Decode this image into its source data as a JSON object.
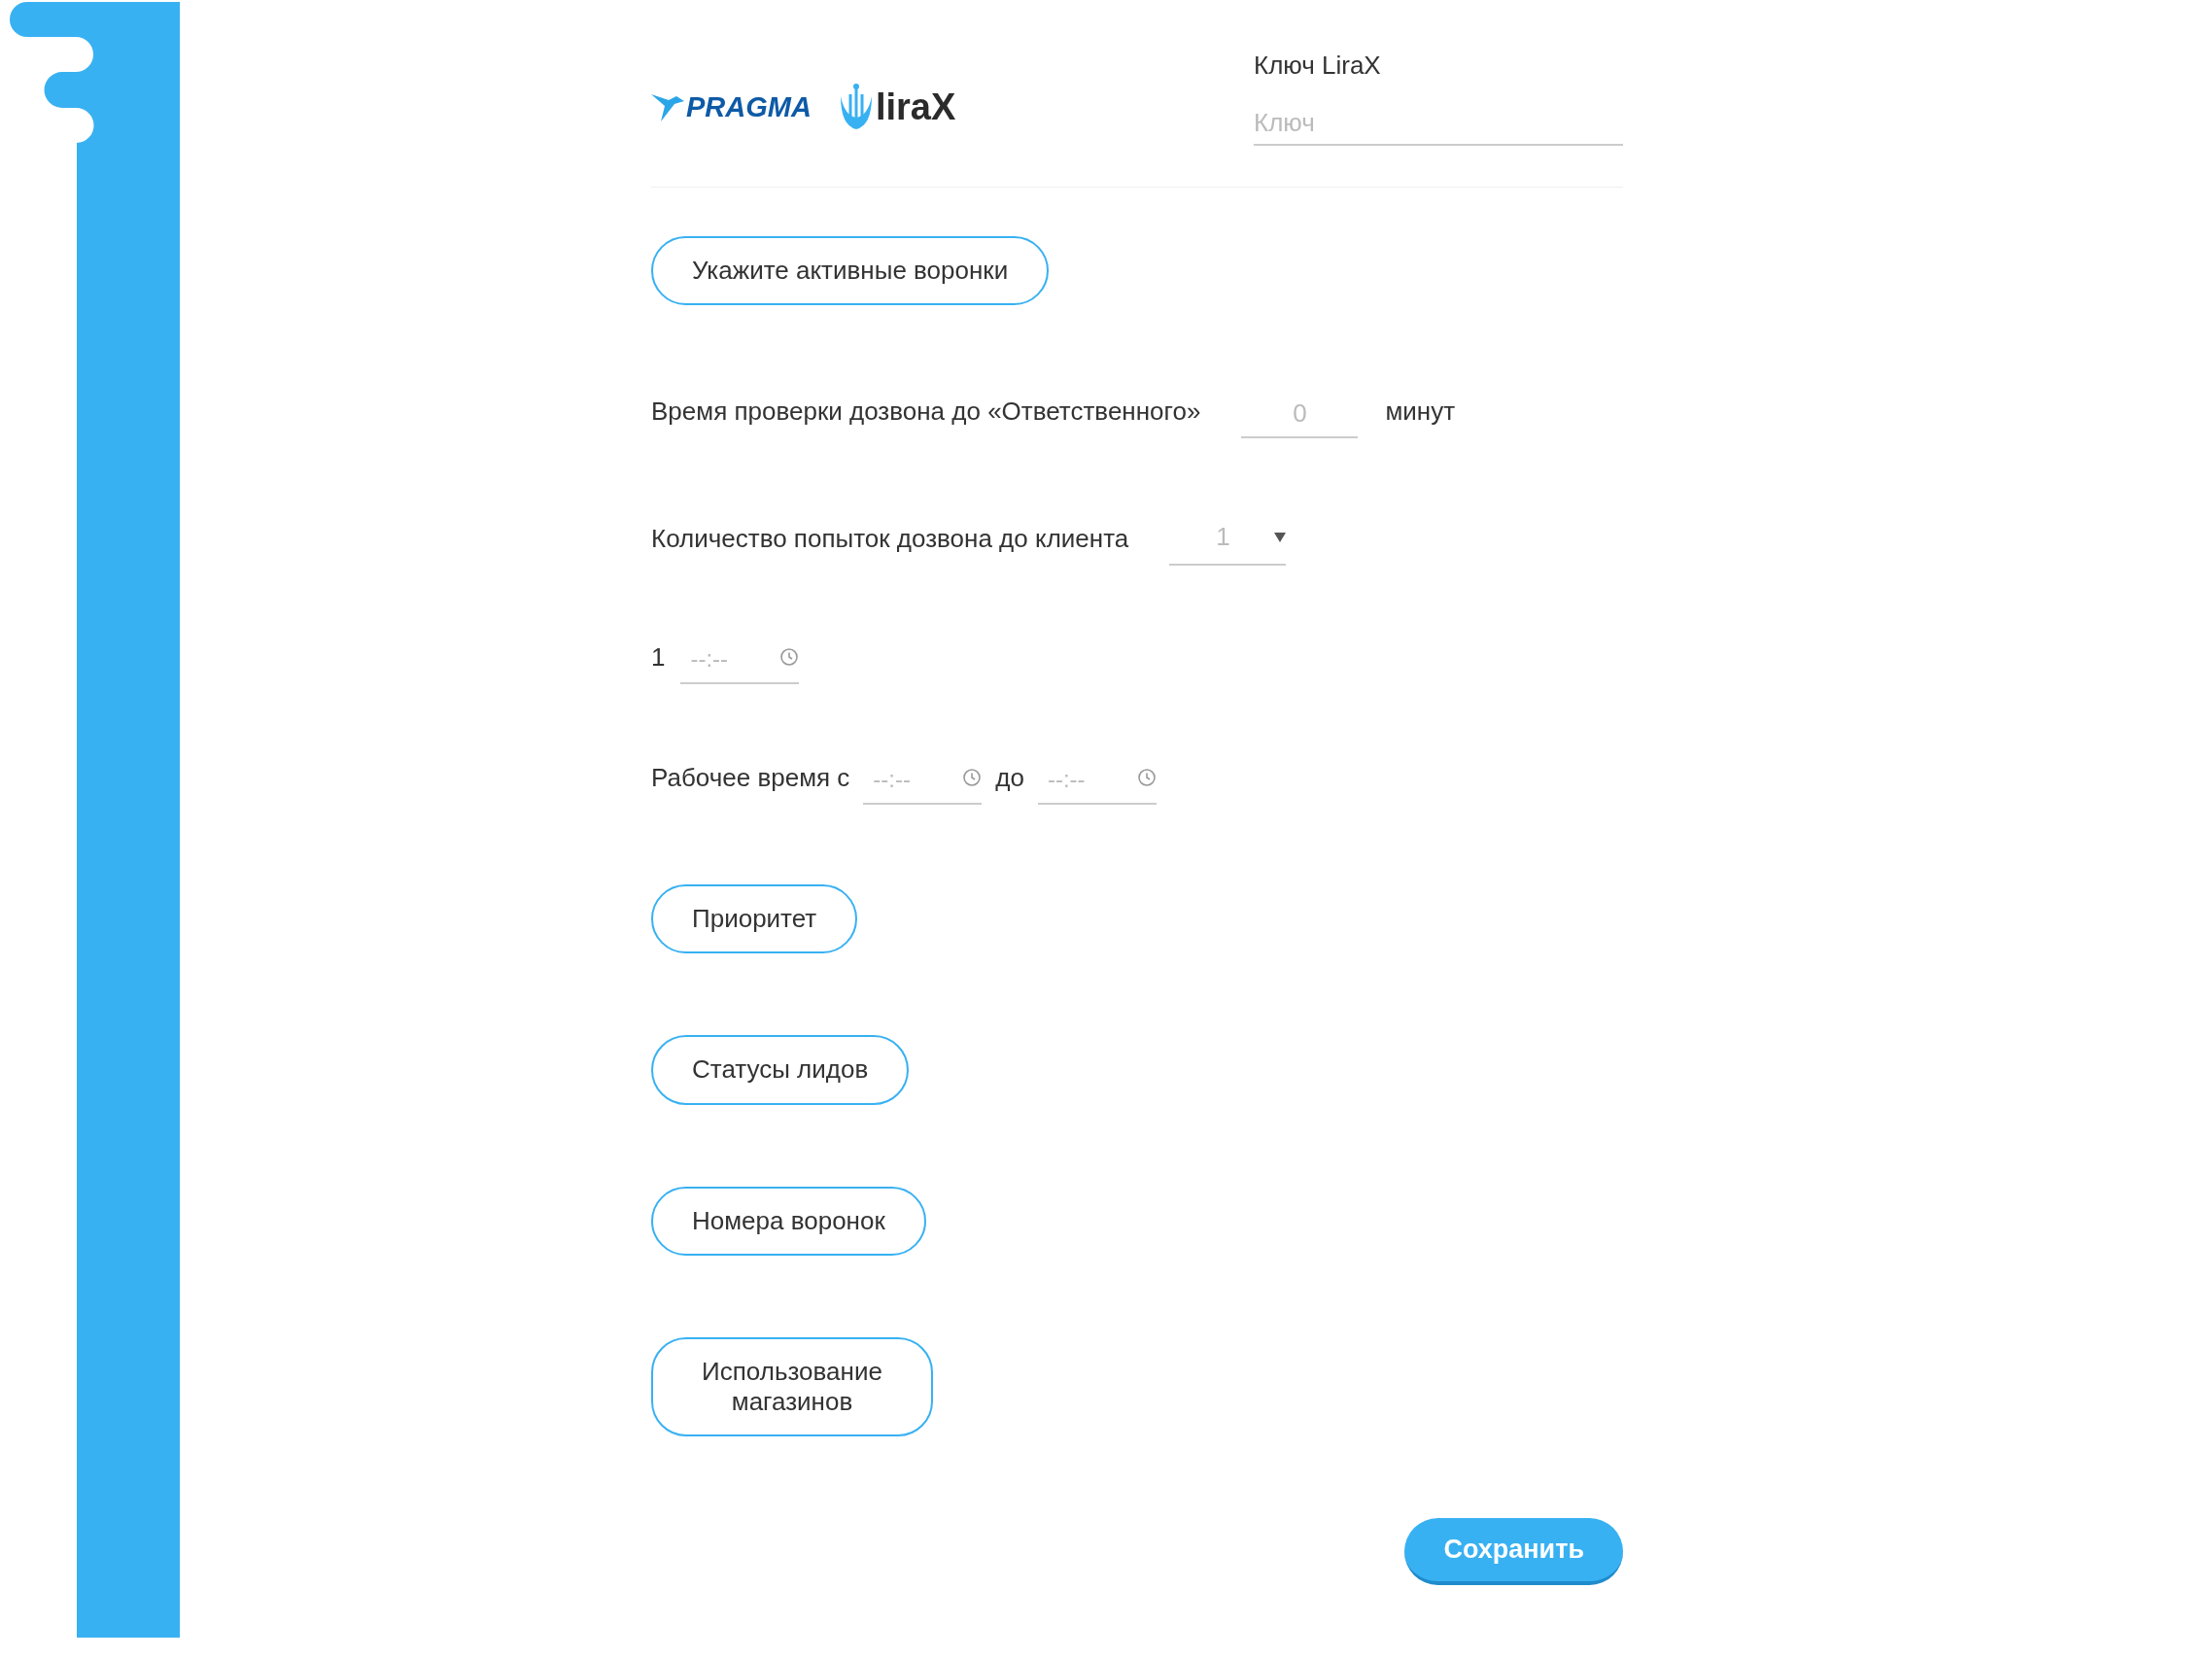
{
  "header": {
    "logos": [
      {
        "kind": "pragma",
        "text": "PRAGMA"
      },
      {
        "kind": "lirax",
        "text": "liraX"
      }
    ],
    "key_field": {
      "label": "Ключ LiraX",
      "placeholder": "Ключ"
    }
  },
  "funnels_button": "Укажите активные воронки",
  "check_time": {
    "label": "Время проверки дозвона до «Ответственного»",
    "placeholder": "0",
    "unit": "минут"
  },
  "attempts": {
    "label": "Количество попыток дозвона до клиента",
    "value": "1"
  },
  "attempt_times": [
    {
      "number": "1",
      "placeholder": "--:--"
    }
  ],
  "working_time": {
    "label": "Рабочее время с",
    "from_placeholder": "--:--",
    "separator": "до",
    "to_placeholder": "--:--"
  },
  "buttons": [
    "Приоритет",
    "Статусы лидов",
    "Номера воронок",
    "Использование магазинов"
  ],
  "save_button": "Сохранить"
}
